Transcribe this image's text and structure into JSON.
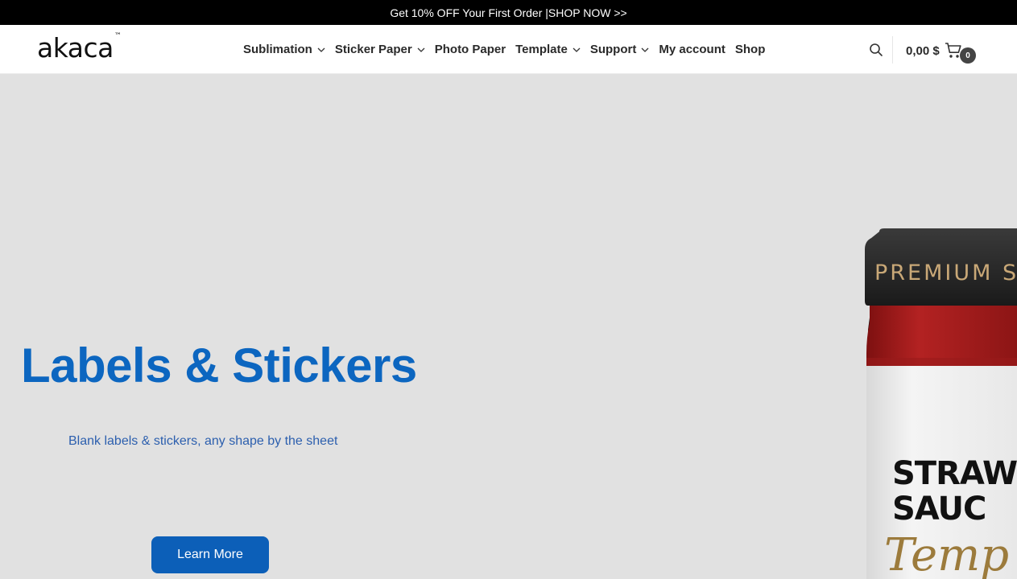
{
  "promo": {
    "text": "Get 10% OFF Your First Order | ",
    "link": "SHOP NOW >>"
  },
  "header": {
    "logo": "akaca",
    "logo_mark": "™",
    "nav": [
      {
        "label": "Sublimation",
        "has_dropdown": true
      },
      {
        "label": "Sticker Paper",
        "has_dropdown": true
      },
      {
        "label": "Photo Paper",
        "has_dropdown": false
      },
      {
        "label": "Template",
        "has_dropdown": true
      },
      {
        "label": "Support",
        "has_dropdown": true
      },
      {
        "label": "My account",
        "has_dropdown": false
      },
      {
        "label": "Shop",
        "has_dropdown": false
      }
    ],
    "search_icon": "search-icon",
    "cart": {
      "total": "0,00 $",
      "count": "0",
      "icon": "cart-icon"
    }
  },
  "hero": {
    "title": "Labels & Stickers",
    "subtitle": "Blank labels & stickers, any shape by the sheet",
    "button": "Learn More",
    "product": {
      "cap_text": "PREMIUM S",
      "label_line1": "STRAW",
      "label_line2": "SAUC",
      "script_text": "Temp"
    }
  },
  "colors": {
    "accent": "#0c66c0",
    "button": "#0c5fb8",
    "promo_bg": "#000000",
    "hero_bg": "#e1e1e1",
    "jar_red": "#a11d1d"
  }
}
